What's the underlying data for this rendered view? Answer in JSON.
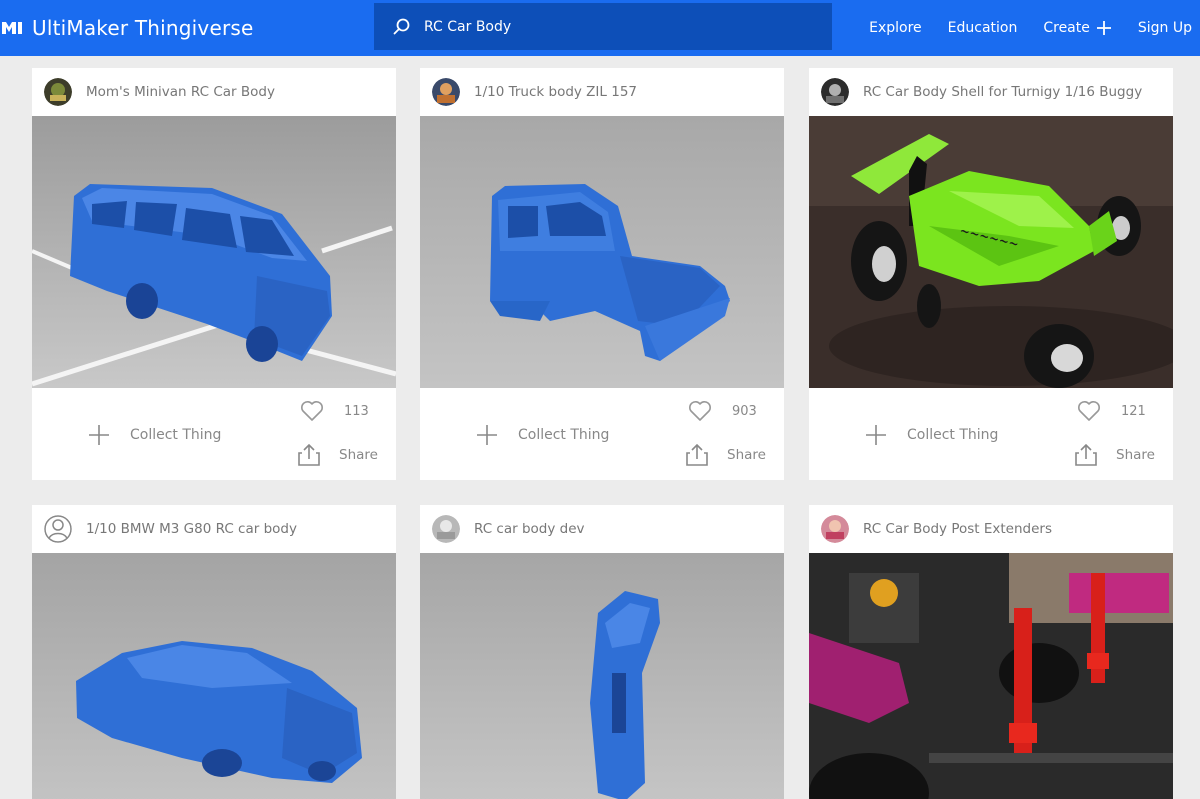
{
  "header": {
    "brand": "UltiMaker Thingiverse",
    "search_value": "RC Car Body",
    "nav": [
      "Explore",
      "Education",
      "Create",
      "Sign Up"
    ]
  },
  "colors": {
    "header_bg": "#1a6cf0",
    "search_bg": "#0d4fb8",
    "model_blue": "#2f6fd6",
    "background": "#ececec"
  },
  "cards": [
    {
      "title": "Mom's Minivan RC Car Body",
      "likes": "113",
      "collect_label": "Collect Thing",
      "share_label": "Share"
    },
    {
      "title": "1/10 Truck body ZIL 157",
      "likes": "903",
      "collect_label": "Collect Thing",
      "share_label": "Share"
    },
    {
      "title": "RC Car Body Shell for Turnigy 1/16 Buggy",
      "likes": "121",
      "collect_label": "Collect Thing",
      "share_label": "Share"
    },
    {
      "title": "1/10 BMW M3 G80 RC car body"
    },
    {
      "title": "RC car body dev"
    },
    {
      "title": "RC Car Body Post Extenders"
    }
  ]
}
